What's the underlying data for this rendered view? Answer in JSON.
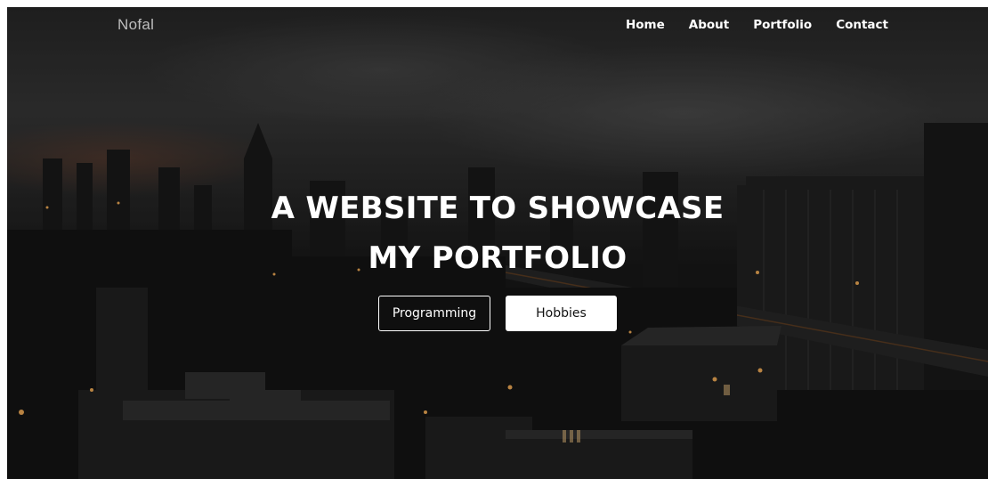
{
  "nav": {
    "brand": "Nofal",
    "links": [
      {
        "label": "Home"
      },
      {
        "label": "About"
      },
      {
        "label": "Portfolio"
      },
      {
        "label": "Contact"
      }
    ]
  },
  "hero": {
    "title_line1": "A WEBSITE TO SHOWCASE",
    "title_line2": "MY PORTFOLIO",
    "buttons": {
      "primary_label": "Programming",
      "secondary_label": "Hobbies"
    }
  },
  "colors": {
    "text": "#ffffff",
    "brand_text": "#bdbdbd",
    "button_solid_bg": "#ffffff",
    "button_solid_text": "#111111",
    "background": "#141414"
  }
}
